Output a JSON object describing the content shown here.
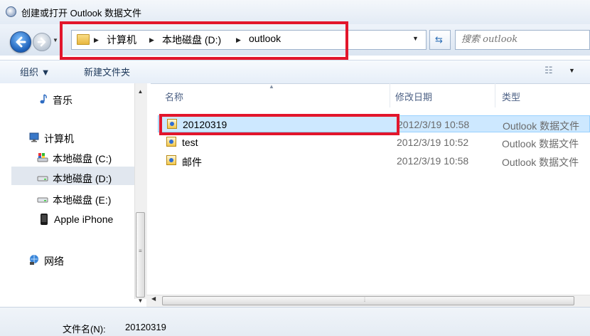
{
  "window": {
    "title": "创建或打开 Outlook 数据文件"
  },
  "address_bar": {
    "crumbs": [
      "计算机",
      "本地磁盘 (D:)",
      "outlook"
    ]
  },
  "search": {
    "placeholder": "搜索 outlook"
  },
  "toolbar": {
    "organize_label": "组织 ▼",
    "new_folder_label": "新建文件夹"
  },
  "sidebar": {
    "items": [
      {
        "label": "音乐",
        "icon": "music-note-icon"
      },
      {
        "label": "计算机",
        "icon": "computer-icon"
      },
      {
        "label": "本地磁盘 (C:)",
        "icon": "system-drive-icon"
      },
      {
        "label": "本地磁盘 (D:)",
        "icon": "drive-icon",
        "selected": true
      },
      {
        "label": "本地磁盘 (E:)",
        "icon": "drive-icon"
      },
      {
        "label": "Apple iPhone",
        "icon": "phone-icon"
      },
      {
        "label": "网络",
        "icon": "network-icon"
      }
    ]
  },
  "file_list": {
    "columns": [
      "名称",
      "修改日期",
      "类型"
    ],
    "rows": [
      {
        "name": "20120319",
        "date": "2012/3/19 10:58",
        "type": "Outlook 数据文件",
        "selected": true
      },
      {
        "name": "test",
        "date": "2012/3/19 10:52",
        "type": "Outlook 数据文件"
      },
      {
        "name": "邮件",
        "date": "2012/3/19 10:58",
        "type": "Outlook 数据文件"
      }
    ]
  },
  "filename": {
    "label": "文件名(N):",
    "value": "20120319"
  },
  "colors": {
    "highlight": "#e2162c",
    "selection": "#cde8ff",
    "accent": "#1b5fb8"
  }
}
